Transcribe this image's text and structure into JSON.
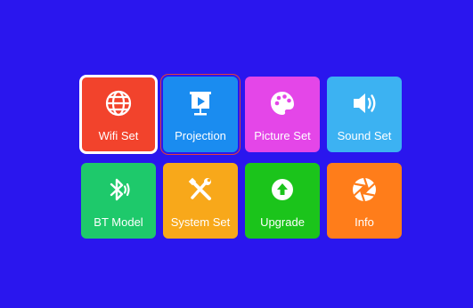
{
  "menu": {
    "tiles": [
      {
        "label": "Wifi Set",
        "color": "#f2432c",
        "icon": "globe-icon"
      },
      {
        "label": "Projection",
        "color": "#1a8cf0",
        "icon": "projector-screen-icon"
      },
      {
        "label": "Picture Set",
        "color": "#e446e8",
        "icon": "palette-icon"
      },
      {
        "label": "Sound Set",
        "color": "#3cb2f2",
        "icon": "speaker-icon"
      },
      {
        "label": "BT Model",
        "color": "#1ec96b",
        "icon": "bluetooth-icon"
      },
      {
        "label": "System Set",
        "color": "#f8a81a",
        "icon": "tools-icon"
      },
      {
        "label": "Upgrade",
        "color": "#1bc41b",
        "icon": "upgrade-arrow-icon"
      },
      {
        "label": "Info",
        "color": "#ff7d1a",
        "icon": "aperture-icon"
      }
    ]
  },
  "colors": {
    "background": "#2a16ee",
    "focus_outline": "#ffffff",
    "cursor_outline": "#e0403a"
  }
}
